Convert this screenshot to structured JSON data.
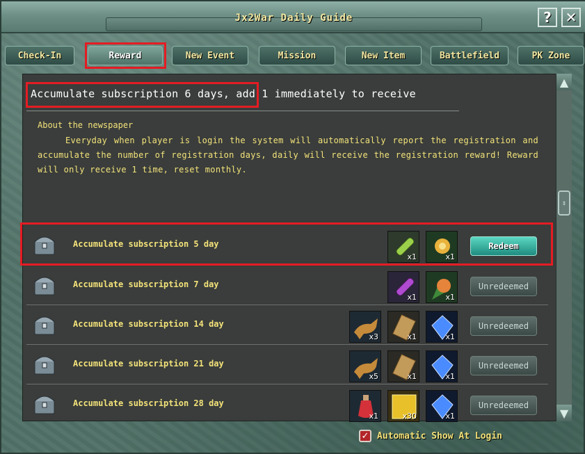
{
  "window": {
    "title": "Jx2War Daily Guide",
    "help_label": "?",
    "close_label": "✕"
  },
  "tabs": [
    {
      "label": "Check-In",
      "active": false
    },
    {
      "label": "Reward",
      "active": true
    },
    {
      "label": "New Event",
      "active": false
    },
    {
      "label": "Mission",
      "active": false
    },
    {
      "label": "New Item",
      "active": false
    },
    {
      "label": "Battlefield",
      "active": false
    },
    {
      "label": "PK Zone",
      "active": false
    }
  ],
  "headline": {
    "highlight": "Accumulate subscription 6 days,",
    "rest": " add 1 immediately to receive"
  },
  "about": {
    "title": "About the newspaper",
    "body": "Everyday when player is login the system will automatically report the registration and accumulate the number of registration days, daily will receive the registration reward! Reward will only receive 1 time, reset monthly."
  },
  "rewards": [
    {
      "label": "Accumulate subscription 5 day",
      "status": "Redeem",
      "items": [
        {
          "icon": "green-scroll-icon",
          "qty": "x1"
        },
        {
          "icon": "golden-flower-icon",
          "qty": "x1"
        }
      ]
    },
    {
      "label": "Accumulate subscription 7 day",
      "status": "Unredeemed",
      "items": [
        {
          "icon": "purple-scroll-icon",
          "qty": "x1"
        },
        {
          "icon": "orange-flower-icon",
          "qty": "x1"
        }
      ]
    },
    {
      "label": "Accumulate subscription 14 day",
      "status": "Unredeemed",
      "items": [
        {
          "icon": "horse-icon",
          "qty": "x3"
        },
        {
          "icon": "parchment-icon",
          "qty": "x1"
        },
        {
          "icon": "blue-gem-icon",
          "qty": "x1"
        }
      ]
    },
    {
      "label": "Accumulate subscription 21 day",
      "status": "Unredeemed",
      "items": [
        {
          "icon": "horse-icon",
          "qty": "x5"
        },
        {
          "icon": "parchment-icon",
          "qty": "x1"
        },
        {
          "icon": "blue-gem-icon",
          "qty": "x1"
        }
      ]
    },
    {
      "label": "Accumulate subscription 28 day",
      "status": "Unredeemed",
      "items": [
        {
          "icon": "red-potion-icon",
          "qty": "x1"
        },
        {
          "icon": "gold-block-icon",
          "qty": "x30"
        },
        {
          "icon": "blue-gem-icon",
          "qty": "x1"
        }
      ]
    }
  ],
  "footer": {
    "auto_show_label": "Automatic Show At Login",
    "auto_show_checked": true
  },
  "colors": {
    "highlight_outline": "#e51c23",
    "text_gold": "#f3e27a",
    "redeem_button": "#2fb5a2"
  }
}
